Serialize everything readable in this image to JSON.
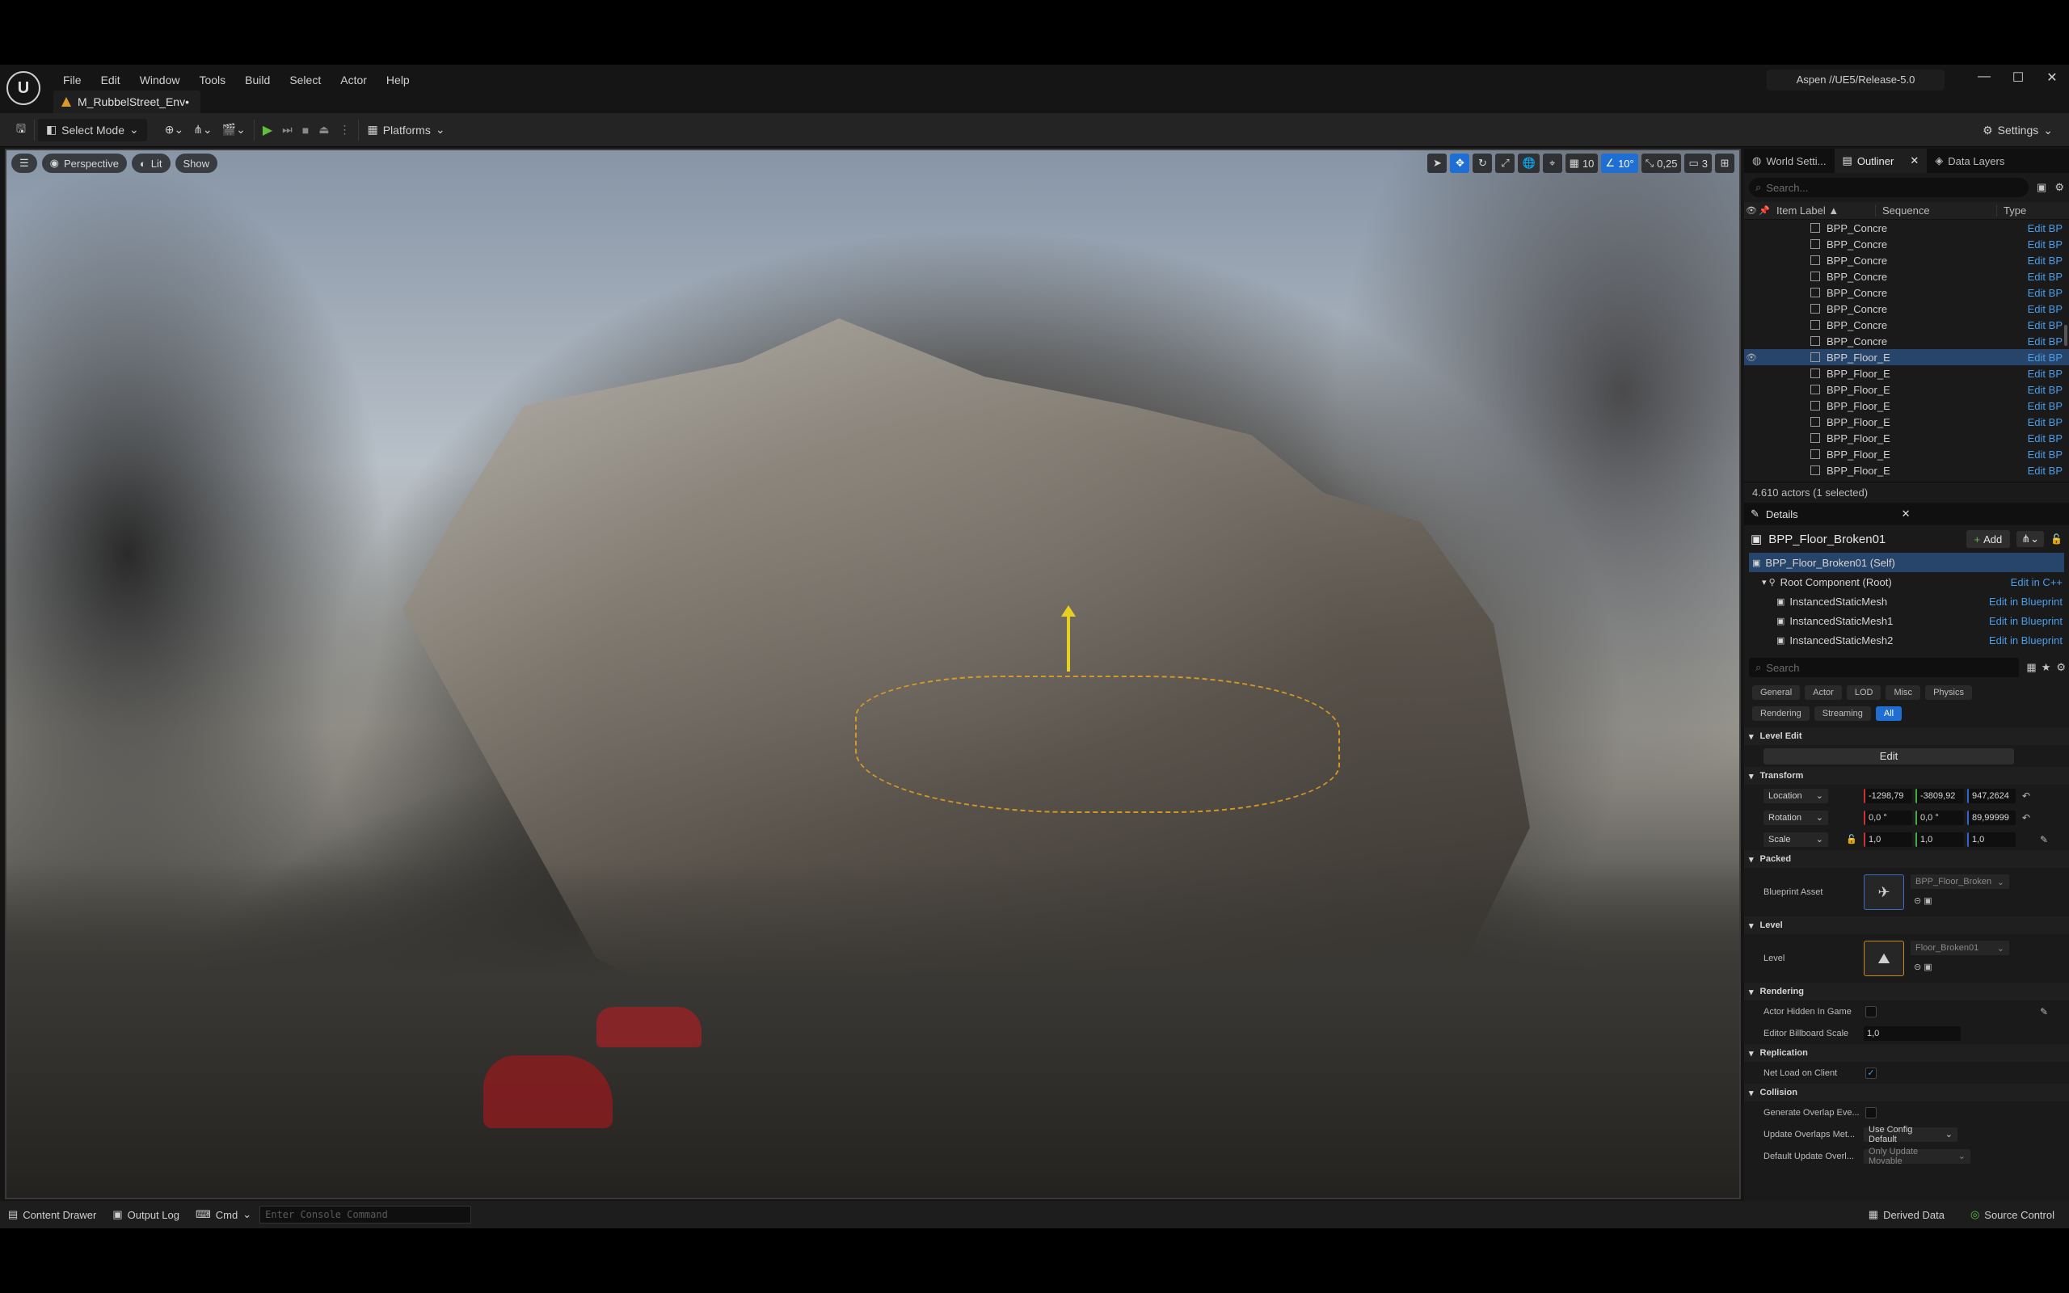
{
  "menu": [
    "File",
    "Edit",
    "Window",
    "Tools",
    "Build",
    "Select",
    "Actor",
    "Help"
  ],
  "doc_tab": "M_RubbelStreet_Env•",
  "project": "Aspen //UE5/Release-5.0",
  "toolbar": {
    "mode": "Select Mode",
    "platforms": "Platforms",
    "settings": "Settings"
  },
  "viewport": {
    "perspective": "Perspective",
    "lit": "Lit",
    "show": "Show",
    "grid": "10",
    "angle": "10°",
    "scale": "0,25",
    "camera_speed": "3"
  },
  "outliner": {
    "tabs": [
      "World Setti...",
      "Outliner",
      "Data Layers"
    ],
    "search_placeholder": "Search...",
    "col_label": "Item Label ▲",
    "col_sequence": "Sequence",
    "col_type": "Type",
    "rows": [
      {
        "label": "BPP_Concre",
        "type": "Edit BP"
      },
      {
        "label": "BPP_Concre",
        "type": "Edit BP"
      },
      {
        "label": "BPP_Concre",
        "type": "Edit BP"
      },
      {
        "label": "BPP_Concre",
        "type": "Edit BP"
      },
      {
        "label": "BPP_Concre",
        "type": "Edit BP"
      },
      {
        "label": "BPP_Concre",
        "type": "Edit BP"
      },
      {
        "label": "BPP_Concre",
        "type": "Edit BP"
      },
      {
        "label": "BPP_Concre",
        "type": "Edit BP"
      },
      {
        "label": "BPP_Floor_E",
        "type": "Edit BP"
      },
      {
        "label": "BPP_Floor_E",
        "type": "Edit BP"
      },
      {
        "label": "BPP_Floor_E",
        "type": "Edit BP"
      },
      {
        "label": "BPP_Floor_E",
        "type": "Edit BP"
      },
      {
        "label": "BPP_Floor_E",
        "type": "Edit BP"
      },
      {
        "label": "BPP_Floor_E",
        "type": "Edit BP"
      },
      {
        "label": "BPP_Floor_E",
        "type": "Edit BP"
      },
      {
        "label": "BPP_Floor_E",
        "type": "Edit BP"
      }
    ],
    "selected_index": 8,
    "footer": "4.610 actors (1 selected)"
  },
  "details": {
    "tab": "Details",
    "actor": "BPP_Floor_Broken01",
    "add": "Add",
    "components": [
      {
        "label": "BPP_Floor_Broken01 (Self)",
        "link": ""
      },
      {
        "label": "Root Component (Root)",
        "link": "Edit in C++"
      },
      {
        "label": "InstancedStaticMesh",
        "link": "Edit in Blueprint"
      },
      {
        "label": "InstancedStaticMesh1",
        "link": "Edit in Blueprint"
      },
      {
        "label": "InstancedStaticMesh2",
        "link": "Edit in Blueprint"
      }
    ],
    "search_placeholder": "Search",
    "filters_row1": [
      "General",
      "Actor",
      "LOD",
      "Misc",
      "Physics"
    ],
    "filters_row2": [
      "Rendering",
      "Streaming",
      "All"
    ],
    "sections": {
      "level_edit": "Level Edit",
      "edit_btn": "Edit",
      "transform": "Transform",
      "location": "Location",
      "loc": [
        "-1298,79",
        "-3809,92",
        "947,2624"
      ],
      "rotation": "Rotation",
      "rot": [
        "0,0 °",
        "0,0 °",
        "89,99999"
      ],
      "scale": "Scale",
      "scl": [
        "1,0",
        "1,0",
        "1,0"
      ],
      "packed": "Packed",
      "blueprint_asset": "Blueprint Asset",
      "bp_value": "BPP_Floor_Broken",
      "level": "Level",
      "level_label": "Level",
      "level_value": "Floor_Broken01",
      "rendering": "Rendering",
      "hidden": "Actor Hidden In Game",
      "billboard": "Editor Billboard Scale",
      "billboard_value": "1,0",
      "replication": "Replication",
      "net_load": "Net Load on Client",
      "collision": "Collision",
      "gen_overlap": "Generate Overlap Eve...",
      "update_overlaps": "Update Overlaps Met...",
      "update_value": "Use Config Default",
      "default_update": "Default Update Overl...",
      "default_value": "Only Update Movable"
    }
  },
  "statusbar": {
    "content_drawer": "Content Drawer",
    "output_log": "Output Log",
    "cmd": "Cmd",
    "console_placeholder": "Enter Console Command",
    "derived": "Derived Data",
    "source": "Source Control"
  },
  "colors": {
    "accent": "#1f6ed4",
    "link": "#4a9de8",
    "selection": "#27456b",
    "play": "#5fbf3a"
  }
}
